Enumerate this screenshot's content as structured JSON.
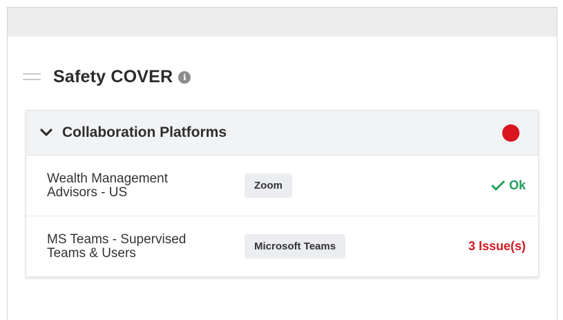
{
  "widget": {
    "title": "Safety COVER",
    "info_icon": "info-icon"
  },
  "section": {
    "title": "Collaboration Platforms",
    "status_color": "#d9151f",
    "expanded": true
  },
  "rows": [
    {
      "name_line1": "Wealth Management",
      "name_line2": "Advisors - US",
      "platform": "Zoom",
      "status": "Ok",
      "status_type": "ok",
      "status_color": "#1e9d5c"
    },
    {
      "name_line1": "MS Teams - Supervised",
      "name_line2": "Teams & Users",
      "platform": "Microsoft Teams",
      "status": "3 Issue(s)",
      "status_type": "issue",
      "status_color": "#d41a22"
    }
  ]
}
